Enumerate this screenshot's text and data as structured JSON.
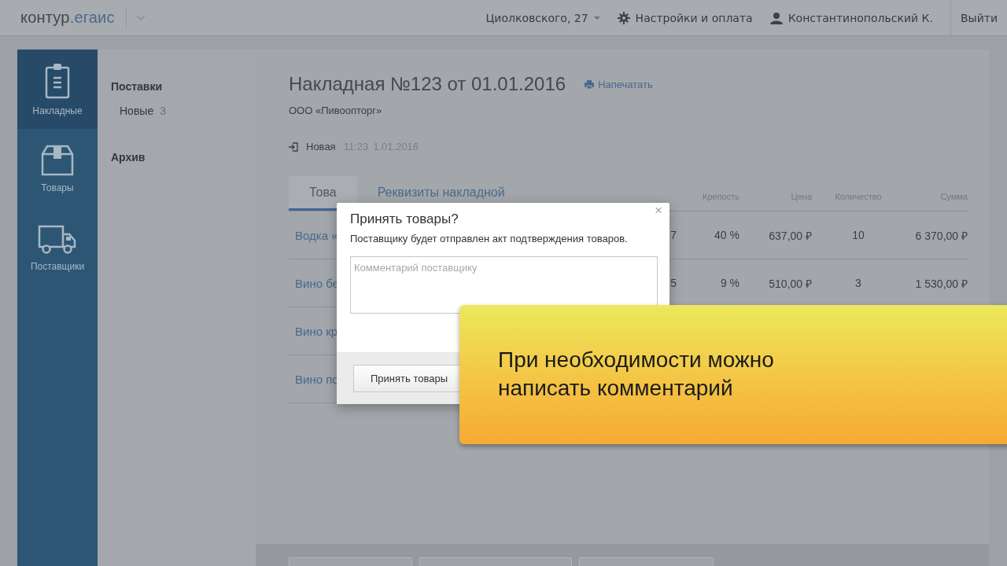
{
  "header": {
    "logo": {
      "brand": "контур",
      "product": ".егаис"
    },
    "address": "Циолковского, 27",
    "settings": "Настройки и оплата",
    "user": "Константинопольский К.",
    "logout": "Выйти"
  },
  "nav": [
    {
      "label": "Накладные",
      "selected": true
    },
    {
      "label": "Товары",
      "selected": false
    },
    {
      "label": "Поставщики",
      "selected": false
    }
  ],
  "subnav": [
    {
      "label": "Поставки",
      "children": [
        {
          "label": "Новые",
          "count": "3"
        }
      ]
    },
    {
      "label": "Архив"
    }
  ],
  "document": {
    "title": "Накладная №123 от 01.01.2016",
    "print_link": "Напечатать",
    "supplier": "ООО «Пивоопторг»",
    "status": {
      "label": "Новая",
      "time": "11:23",
      "date": "1.01.2016"
    }
  },
  "tabs": [
    {
      "label": "Това",
      "selected": true
    },
    {
      "label": "Реквизиты накладной",
      "selected": false
    }
  ],
  "table": {
    "columns": [
      "",
      "",
      "Крепость",
      "Цена",
      "Количество",
      "Сумма"
    ],
    "rows": [
      {
        "cells": [
          "Водка «",
          "7",
          "40 %",
          "637,00 ₽",
          "10",
          "6 370,00 ₽"
        ]
      },
      {
        "cells": [
          "Вино бе",
          "5",
          "9 %",
          "510,00 ₽",
          "3",
          "1 530,00 ₽"
        ]
      },
      {
        "cells": [
          "Вино кр"
        ]
      },
      {
        "cells": [
          "Вино по"
        ]
      }
    ]
  },
  "footer_buttons": [
    {
      "kind": "button"
    },
    {
      "kind": "button"
    },
    {
      "kind": "button"
    }
  ],
  "dialog": {
    "title": "Принять товары?",
    "message": "Поставщику будет отправлен акт подтверждения товаров.",
    "comment": {
      "placeholder": "Комментарий поставщику"
    },
    "close": "×",
    "accept_button": "Принять товары"
  },
  "callout": {
    "text": "При необходимости можно написать комментарий"
  }
}
